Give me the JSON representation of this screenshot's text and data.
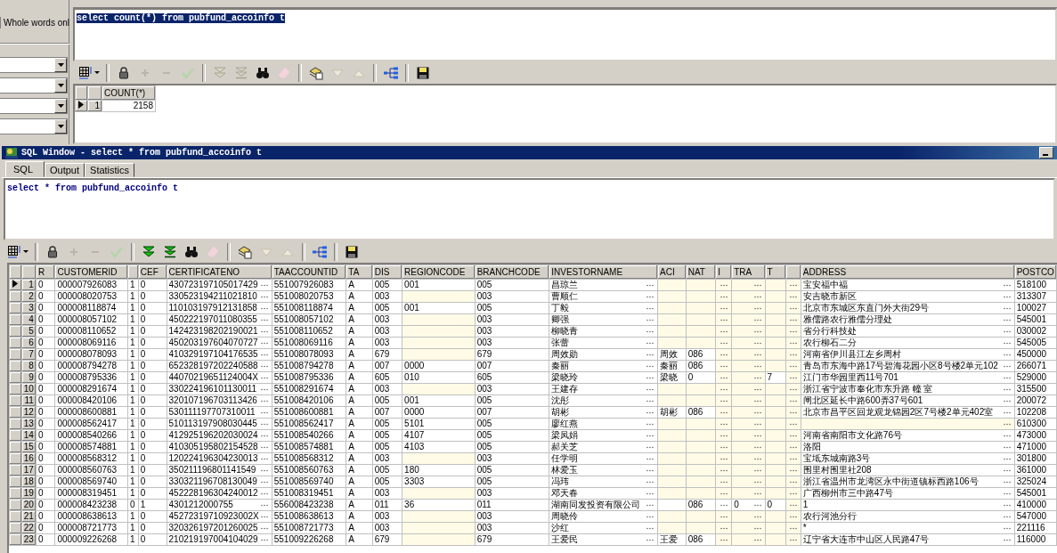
{
  "find_panel": {
    "whole_words": {
      "label": "Whole words onl",
      "checked": false
    }
  },
  "query_window": {
    "editor": {
      "text": "select count(*) from pubfund_accoinfo t",
      "selected": true
    },
    "toolbar": [
      [
        {
          "kind": "grid",
          "disabled": false
        }
      ],
      [
        {
          "kind": "lock",
          "disabled": false
        },
        {
          "kind": "plus",
          "disabled": true
        },
        {
          "kind": "minus",
          "disabled": true
        },
        {
          "kind": "check",
          "disabled": true
        }
      ],
      [
        {
          "kind": "next",
          "disabled": true
        },
        {
          "kind": "last",
          "disabled": true
        },
        {
          "kind": "find",
          "disabled": false
        },
        {
          "kind": "eraser",
          "disabled": true
        }
      ],
      [
        {
          "kind": "stack",
          "disabled": false
        },
        {
          "kind": "down",
          "disabled": true
        },
        {
          "kind": "up",
          "disabled": true
        }
      ],
      [
        {
          "kind": "tree",
          "disabled": false
        }
      ],
      [
        {
          "kind": "save",
          "disabled": false
        }
      ]
    ],
    "result": {
      "columns": [
        "COUNT(*)"
      ],
      "rows": [
        {
          "number": "1",
          "current": true,
          "cells": [
            "2158"
          ]
        }
      ]
    }
  },
  "sql_window": {
    "title": "SQL Window - select * from pubfund_accoinfo t",
    "tabs": [
      {
        "label": "SQL",
        "selected": true
      },
      {
        "label": "Output",
        "selected": false
      },
      {
        "label": "Statistics",
        "selected": false
      }
    ],
    "editor": {
      "text": "select * from pubfund_accoinfo t",
      "selected": false
    },
    "toolbar": [
      [
        {
          "kind": "grid",
          "disabled": false
        }
      ],
      [
        {
          "kind": "lock",
          "disabled": false
        },
        {
          "kind": "plus",
          "disabled": true
        },
        {
          "kind": "minus",
          "disabled": true
        },
        {
          "kind": "check",
          "disabled": true
        }
      ],
      [
        {
          "kind": "next",
          "disabled": false
        },
        {
          "kind": "last",
          "disabled": false
        },
        {
          "kind": "find",
          "disabled": false
        },
        {
          "kind": "eraser",
          "disabled": true
        }
      ],
      [
        {
          "kind": "stack",
          "disabled": false
        },
        {
          "kind": "down",
          "disabled": true
        },
        {
          "kind": "up",
          "disabled": true
        }
      ],
      [
        {
          "kind": "tree",
          "disabled": false
        }
      ],
      [
        {
          "kind": "save",
          "disabled": false
        }
      ]
    ],
    "grid": {
      "columns": [
        {
          "label": "R",
          "kind": "plain"
        },
        {
          "label": "CUSTOMERID",
          "kind": "plain"
        },
        {
          "kind": "plain"
        },
        {
          "label": "CEF",
          "kind": "plain"
        },
        {
          "label": "CERTIFICATENO",
          "kind": "lookup"
        },
        {
          "label": "TAACCOUNTID",
          "kind": "plain"
        },
        {
          "label": "TA",
          "kind": "plain"
        },
        {
          "label": "DIS",
          "kind": "plain"
        },
        {
          "label": "REGIONCODE",
          "kind": "plain"
        },
        {
          "label": "BRANCHCODE",
          "kind": "plain"
        },
        {
          "label": "INVESTORNAME",
          "kind": "lookup"
        },
        {
          "label": "ACI",
          "kind": "plain"
        },
        {
          "label": "NAT",
          "kind": "plain"
        },
        {
          "label": "I",
          "kind": "lookup"
        },
        {
          "label": "TRA",
          "kind": "lookup"
        },
        {
          "label": "T",
          "kind": "plain"
        },
        {
          "kind": "lookup"
        },
        {
          "label": "ADDRESS",
          "kind": "lookup"
        },
        {
          "label": "POSTCO",
          "kind": "plain"
        }
      ],
      "rows": [
        {
          "number": "1",
          "current": true,
          "cells": [
            "0",
            "000007926083",
            "1",
            "0",
            "430723197105017429",
            "551007926083",
            "A",
            "005",
            "001",
            "005",
            "昌琼兰",
            null,
            null,
            null,
            null,
            null,
            null,
            "宝安福中福",
            "518100"
          ]
        },
        {
          "number": "2",
          "current": false,
          "cells": [
            "0",
            "000008020753",
            "1",
            "0",
            "330523194211021810",
            "551008020753",
            "A",
            "003",
            null,
            "003",
            "曹顺仁",
            null,
            null,
            null,
            null,
            null,
            null,
            "安吉晓市新区",
            "313307"
          ]
        },
        {
          "number": "3",
          "current": false,
          "cells": [
            "0",
            "000008118874",
            "1",
            "0",
            "110103197912131858",
            "551008118874",
            "A",
            "005",
            "001",
            "005",
            "丁毅",
            null,
            null,
            null,
            null,
            null,
            null,
            "北京市东城区东直门外大街29号",
            "100027"
          ]
        },
        {
          "number": "4",
          "current": false,
          "cells": [
            "0",
            "000008057102",
            "1",
            "0",
            "450222197011080355",
            "551008057102",
            "A",
            "003",
            null,
            "003",
            "卿强",
            null,
            null,
            null,
            null,
            null,
            null,
            "雅儒路农行雅儒分理处",
            "545001"
          ]
        },
        {
          "number": "5",
          "current": false,
          "cells": [
            "0",
            "000008110652",
            "1",
            "0",
            "142423198202190021",
            "551008110652",
            "A",
            "003",
            null,
            "003",
            "柳晓青",
            null,
            null,
            null,
            null,
            null,
            null,
            "省分行科技处",
            "030002"
          ]
        },
        {
          "number": "6",
          "current": false,
          "cells": [
            "0",
            "000008069116",
            "1",
            "0",
            "450203197604070727",
            "551008069116",
            "A",
            "003",
            null,
            "003",
            "张蕾",
            null,
            null,
            null,
            null,
            null,
            null,
            "农行柳石二分",
            "545005"
          ]
        },
        {
          "number": "7",
          "current": false,
          "cells": [
            "0",
            "000008078093",
            "1",
            "0",
            "410329197104176535",
            "551008078093",
            "A",
            "679",
            null,
            "679",
            "周效勋",
            "周效",
            "086",
            null,
            null,
            null,
            null,
            "河南省伊川县江左乡周村",
            "450000"
          ]
        },
        {
          "number": "8",
          "current": false,
          "cells": [
            "0",
            "000008794278",
            "1",
            "0",
            "652328197202240588",
            "551008794278",
            "A",
            "007",
            "0000",
            "007",
            "秦丽",
            "秦丽",
            "086",
            null,
            null,
            null,
            null,
            "青岛市东海中路17号碧海花园小区8号楼2单元102",
            "266071"
          ]
        },
        {
          "number": "9",
          "current": false,
          "cells": [
            "0",
            "000008795336",
            "1",
            "0",
            "44070219651124004X",
            "551008795336",
            "A",
            "605",
            "010",
            "605",
            "梁晓玲",
            "梁晓",
            "0",
            null,
            null,
            "7",
            null,
            "江门市华园里西11号701",
            "529000"
          ]
        },
        {
          "number": "10",
          "current": false,
          "cells": [
            "0",
            "000008291674",
            "1",
            "0",
            "330224196101130011",
            "551008291674",
            "A",
            "003",
            null,
            "003",
            "王建存",
            null,
            null,
            null,
            null,
            null,
            null,
            "浙江省宁波市奉化市东升路 幢 室",
            "315500"
          ]
        },
        {
          "number": "11",
          "current": false,
          "cells": [
            "0",
            "000008420106",
            "1",
            "0",
            "320107196703113426",
            "551008420106",
            "A",
            "005",
            "001",
            "005",
            "沈彤",
            null,
            null,
            null,
            null,
            null,
            null,
            "闸北区延长中路600弄37号601",
            "200072"
          ]
        },
        {
          "number": "12",
          "current": false,
          "cells": [
            "0",
            "000008600881",
            "1",
            "0",
            "530111197707310011",
            "551008600881",
            "A",
            "007",
            "0000",
            "007",
            "胡彬",
            "胡彬",
            "086",
            null,
            null,
            null,
            null,
            "北京市昌平区回龙观龙锦园2区7号楼2单元402室",
            "102208"
          ]
        },
        {
          "number": "13",
          "current": false,
          "cells": [
            "0",
            "000008562417",
            "1",
            "0",
            "510113197908030445",
            "551008562417",
            "A",
            "005",
            "5101",
            "005",
            "廖红燕",
            null,
            null,
            null,
            null,
            null,
            null,
            null,
            "610300"
          ]
        },
        {
          "number": "14",
          "current": false,
          "cells": [
            "0",
            "000008540266",
            "1",
            "0",
            "412925196202030024",
            "551008540266",
            "A",
            "005",
            "4107",
            "005",
            "梁凤娟",
            null,
            null,
            null,
            null,
            null,
            null,
            "河南省南阳市文化路76号",
            "473000"
          ]
        },
        {
          "number": "15",
          "current": false,
          "cells": [
            "0",
            "000008574881",
            "1",
            "0",
            "410305195802154528",
            "551008574881",
            "A",
            "005",
            "4103",
            "005",
            "郝关芝",
            null,
            null,
            null,
            null,
            null,
            null,
            "洛阳",
            "471000"
          ]
        },
        {
          "number": "16",
          "current": false,
          "cells": [
            "0",
            "000008568312",
            "1",
            "0",
            "120224196304230013",
            "551008568312",
            "A",
            "003",
            null,
            "003",
            "任学明",
            null,
            null,
            null,
            null,
            null,
            null,
            "宝坻东城南路3号",
            "301800"
          ]
        },
        {
          "number": "17",
          "current": false,
          "cells": [
            "0",
            "000008560763",
            "1",
            "0",
            "350211196801141549",
            "551008560763",
            "A",
            "005",
            "180",
            "005",
            "林爱玉",
            null,
            null,
            null,
            null,
            null,
            null,
            "围里村围里社208",
            "361000"
          ]
        },
        {
          "number": "18",
          "current": false,
          "cells": [
            "0",
            "000008569740",
            "1",
            "0",
            "330321196708130049",
            "551008569740",
            "A",
            "005",
            "3303",
            "005",
            "冯玮",
            null,
            null,
            null,
            null,
            null,
            null,
            "浙江省温州市龙湾区永中街道镇标西路106号",
            "325024"
          ]
        },
        {
          "number": "19",
          "current": false,
          "cells": [
            "0",
            "000008319451",
            "1",
            "0",
            "452228196304240012",
            "551008319451",
            "A",
            "003",
            null,
            "003",
            "邓天春",
            null,
            null,
            null,
            null,
            null,
            null,
            "广西柳州市三中路47号",
            "545001"
          ]
        },
        {
          "number": "20",
          "current": false,
          "cells": [
            "0",
            "000008423238",
            "0",
            "1",
            "4301212000755",
            "556008423238",
            "A",
            "011",
            "36",
            "011",
            "湖南同发投资有限公司",
            "",
            "086",
            "",
            "0",
            "0",
            null,
            "1",
            "410000"
          ]
        },
        {
          "number": "21",
          "current": false,
          "cells": [
            "0",
            "000008638613",
            "1",
            "0",
            "45272319710923002X",
            "551008638613",
            "A",
            "003",
            null,
            "003",
            "周晓伶",
            null,
            null,
            null,
            null,
            null,
            null,
            "农行河池分行",
            "547000"
          ]
        },
        {
          "number": "22",
          "current": false,
          "cells": [
            "0",
            "000008721773",
            "1",
            "0",
            "320326197201260025",
            "551008721773",
            "A",
            "003",
            null,
            "003",
            "沙红",
            null,
            null,
            null,
            null,
            null,
            null,
            "*",
            "221116"
          ]
        },
        {
          "number": "23",
          "current": false,
          "cells": [
            "0",
            "000009226268",
            "1",
            "0",
            "210219197004104029",
            "551009226268",
            "A",
            "679",
            null,
            "679",
            "王爱民",
            "王爱",
            "086",
            null,
            null,
            null,
            null,
            "辽宁省大连市中山区人民路47号",
            "116000"
          ]
        }
      ]
    }
  }
}
